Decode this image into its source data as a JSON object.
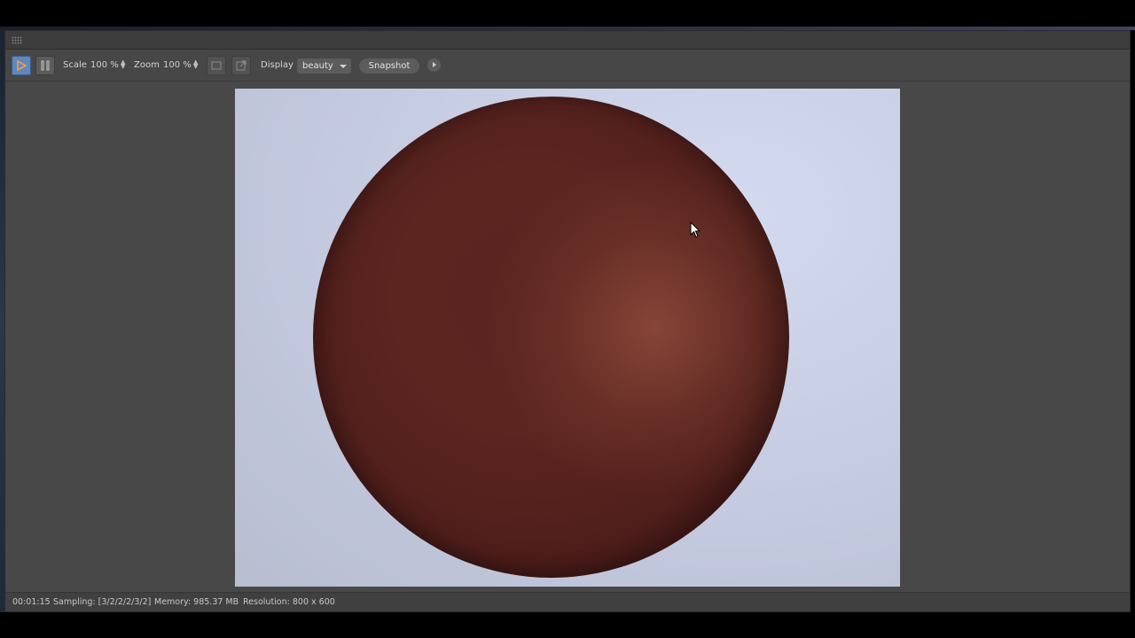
{
  "toolbar": {
    "scale_label": "Scale",
    "scale_value": "100 %",
    "zoom_label": "Zoom",
    "zoom_value": "100 %",
    "display_label": "Display",
    "display_value": "beauty",
    "snapshot_label": "Snapshot"
  },
  "icons": {
    "play": "play-icon",
    "pause": "pause-icon",
    "region": "region-icon",
    "crop": "crop-icon",
    "more": "arrow-right-icon",
    "cursor": "mouse-pointer-icon"
  },
  "status": {
    "time": "00:01:15",
    "sampling": "Sampling: [3/2/2/2/3/2]",
    "memory": "Memory: 985.37 MB",
    "resolution": "Resolution: 800 x 600"
  },
  "colors": {
    "accent_play": "#5f89bd",
    "sphere": "#5a2420",
    "background": "#c7cde3"
  }
}
